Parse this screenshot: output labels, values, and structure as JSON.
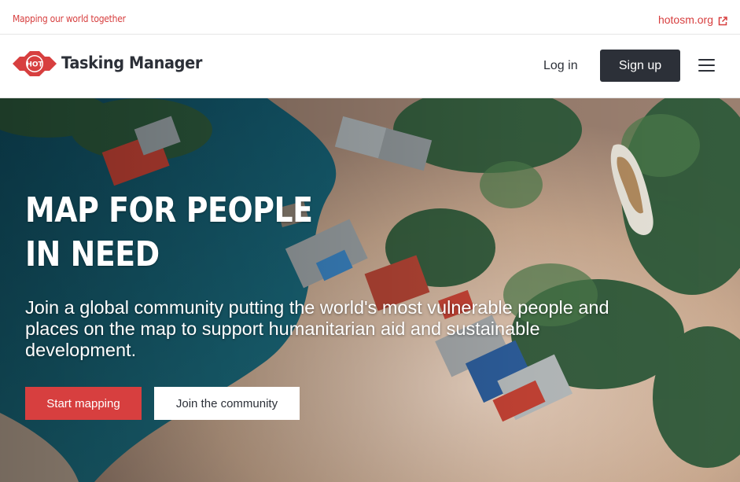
{
  "topbar": {
    "tagline": "Mapping our world together",
    "external_link": "hotosm.org",
    "external_icon": "external-link-icon"
  },
  "navbar": {
    "logo_text": "HOT",
    "brand": "Tasking Manager",
    "login_label": "Log in",
    "signup_label": "Sign up",
    "menu_icon": "hamburger-menu-icon"
  },
  "hero": {
    "title_line1": "MAP FOR PEOPLE",
    "title_line2": "IN NEED",
    "subtitle": "Join a global community putting the world's most vulnerable people and places on the map to support humanitarian aid and sustainable development.",
    "start_label": "Start mapping",
    "join_label": "Join the community"
  },
  "colors": {
    "brand_red": "#d73f3f",
    "dark": "#2c3038",
    "white": "#ffffff"
  }
}
